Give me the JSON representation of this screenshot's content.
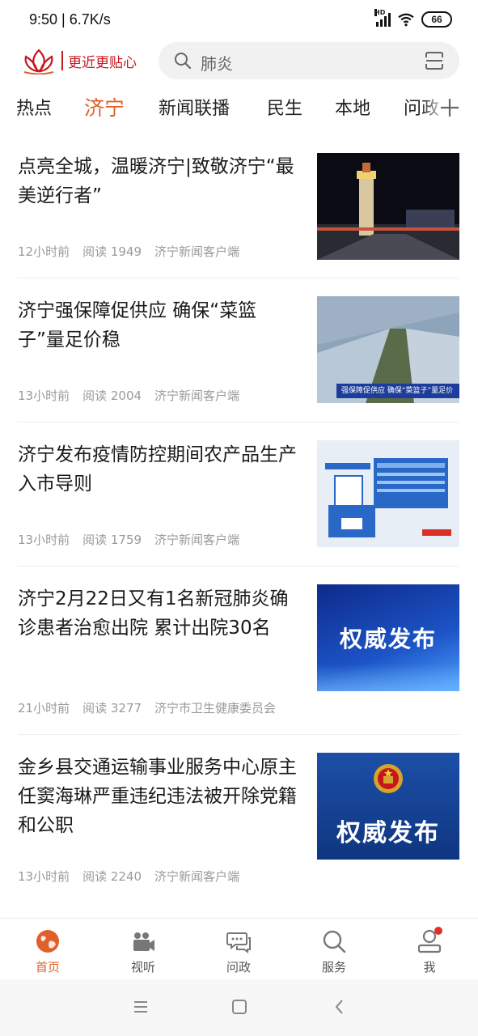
{
  "status_bar": {
    "time_speed": "9:50 | 6.7K/s",
    "network_label": "HD",
    "battery": "66"
  },
  "header": {
    "logo_text": "更近更贴心",
    "search_placeholder": "肺炎"
  },
  "tabs": [
    {
      "label": "热点",
      "active": false
    },
    {
      "label": "济宁",
      "active": true
    },
    {
      "label": "新闻联播",
      "active": false
    },
    {
      "label": "民生",
      "active": false
    },
    {
      "label": "本地",
      "active": false
    },
    {
      "label": "问政",
      "active": false
    }
  ],
  "articles": [
    {
      "title": "点亮全城，温暖济宁|致敬济宁“最美逆行者”",
      "time": "12小时前",
      "reads": "阅读 1949",
      "source": "济宁新闻客户端"
    },
    {
      "title": "济宁强保障促供应 确保“菜篮子”量足价稳",
      "time": "13小时前",
      "reads": "阅读 2004",
      "source": "济宁新闻客户端",
      "thumb_caption": "强保障促供应 确保“菜篮子”量足价"
    },
    {
      "title": "济宁发布疫情防控期间农产品生产入市导则",
      "time": "13小时前",
      "reads": "阅读 1759",
      "source": "济宁新闻客户端"
    },
    {
      "title": "济宁2月22日又有1名新冠肺炎确诊患者治愈出院 累计出院30名",
      "time": "21小时前",
      "reads": "阅读 3277",
      "source": "济宁市卫生健康委员会",
      "thumb_caption": "权威发布"
    },
    {
      "title": "金乡县交通运输事业服务中心原主任窦海琳严重违纪违法被开除党籍和公职",
      "time": "13小时前",
      "reads": "阅读 2240",
      "source": "济宁新闻客户端",
      "thumb_caption": "权威发布"
    }
  ],
  "bottom_nav": [
    {
      "label": "首页",
      "icon": "globe-icon",
      "active": true
    },
    {
      "label": "视听",
      "icon": "video-camera-icon",
      "active": false
    },
    {
      "label": "问政",
      "icon": "chat-bubble-icon",
      "active": false
    },
    {
      "label": "服务",
      "icon": "search-icon",
      "active": false
    },
    {
      "label": "我",
      "icon": "user-icon",
      "active": false
    }
  ],
  "colors": {
    "accent": "#e0602a",
    "brand_red": "#c8161d",
    "meta_gray": "#9a9a9a"
  }
}
